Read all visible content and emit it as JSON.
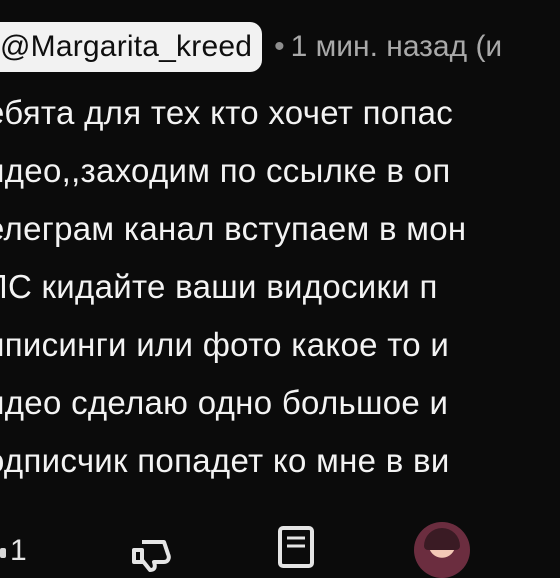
{
  "comment": {
    "author": "@Margarita_kreed",
    "separator": "•",
    "time": "1 мин. назад (и",
    "lines": [
      "ебята для тех кто хочет попас",
      "идео,,заходим по ссылке в оп",
      "елеграм канал вступаем в мон",
      "ЛС  кидайте ваши видосики п",
      "иписинги или фото какое то и",
      "идео сделаю одно большое и",
      "одписчик попадет ко мне в ви"
    ]
  },
  "actions": {
    "like_count": "1",
    "icons": [
      "like-icon",
      "dislike-icon",
      "reply-icon",
      "author-avatar"
    ]
  }
}
